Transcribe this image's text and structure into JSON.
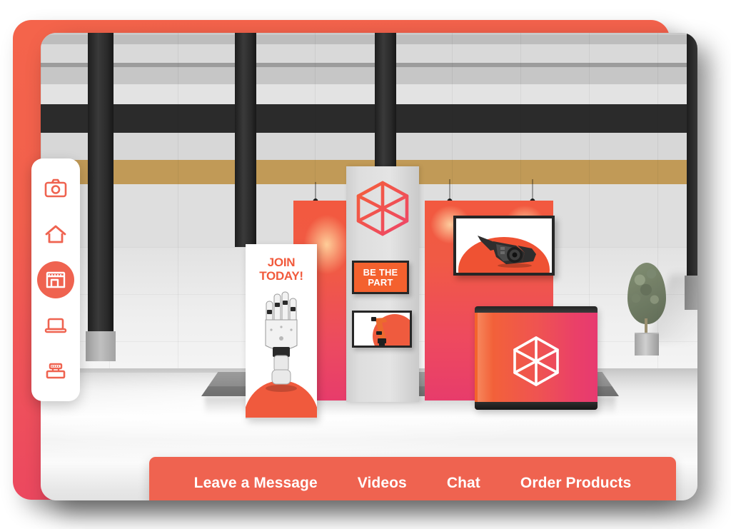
{
  "app": {
    "kind": "virtual-trade-show-booth-viewer",
    "accent_color": "#EF6350",
    "card_gradient_start": "#F4644B",
    "card_gradient_end": "#E83F63"
  },
  "sidebar": {
    "items": [
      {
        "id": "camera",
        "icon": "camera-icon",
        "active": false
      },
      {
        "id": "home",
        "icon": "home-icon",
        "active": false
      },
      {
        "id": "booth",
        "icon": "store-icon",
        "active": true
      },
      {
        "id": "laptop",
        "icon": "laptop-icon",
        "active": false
      },
      {
        "id": "stage",
        "icon": "stage-icon",
        "active": false
      }
    ]
  },
  "bottom_nav": {
    "items": [
      {
        "label": "Leave a Message"
      },
      {
        "label": "Videos"
      },
      {
        "label": "Chat"
      },
      {
        "label": "Order Products"
      }
    ]
  },
  "booth": {
    "sign": {
      "line1": "BE THE",
      "line2": "PART",
      "bg": "#F4612E",
      "text_color": "#FFFFFF"
    },
    "rollup_banner": {
      "line1": "JOIN",
      "line2": "TODAY!",
      "text_color": "#F15A3C"
    },
    "tower_logo": "hexagon-cube-logo",
    "desk_logo": "hexagon-cube-logo",
    "screens": [
      {
        "id": "screen-product-large",
        "content": "power-tool-photo"
      },
      {
        "id": "screen-robot-small",
        "content": "robot-arm-photo"
      }
    ],
    "panel_colors": {
      "left": "#F2593F",
      "right": "#E73C6B",
      "desk_left": "#F4642B",
      "desk_right": "#E73A70"
    }
  },
  "venue": {
    "elements": [
      "tiled-wall",
      "ceiling-beams",
      "dark-pillars",
      "potted-tree",
      "glossy-floor",
      "booth-platform"
    ]
  }
}
